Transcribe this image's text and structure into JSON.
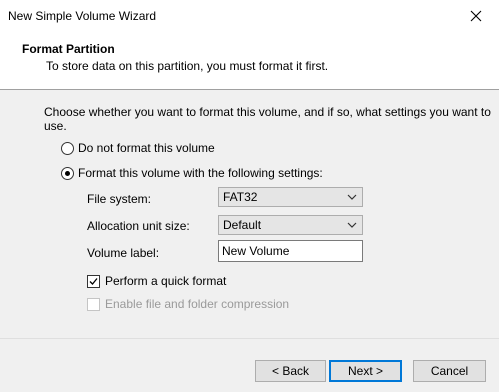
{
  "window": {
    "title": "New Simple Volume Wizard"
  },
  "header": {
    "title": "Format Partition",
    "subtitle": "To store data on this partition, you must format it first."
  },
  "main": {
    "intro": "Choose whether you want to format this volume, and if so, what settings you want to use.",
    "option_no_format": {
      "label": "Do not format this volume",
      "selected": false
    },
    "option_format": {
      "label": "Format this volume with the following settings:",
      "selected": true
    },
    "file_system": {
      "label": "File system:",
      "value": "FAT32"
    },
    "allocation_unit": {
      "label": "Allocation unit size:",
      "value": "Default"
    },
    "volume_label": {
      "label": "Volume label:",
      "value": "New Volume"
    },
    "quick_format": {
      "label": "Perform a quick format",
      "checked": true
    },
    "compression": {
      "label": "Enable file and folder compression",
      "checked": false,
      "enabled": false
    }
  },
  "footer": {
    "back_label": "< Back",
    "next_label": "Next >",
    "cancel_label": "Cancel"
  },
  "icons": {
    "close": "close-icon",
    "dropdown": "chevron-down-icon",
    "check": "checkmark-icon"
  },
  "colors": {
    "accent": "#0078d7",
    "disabled_text": "#9a9a9a"
  }
}
